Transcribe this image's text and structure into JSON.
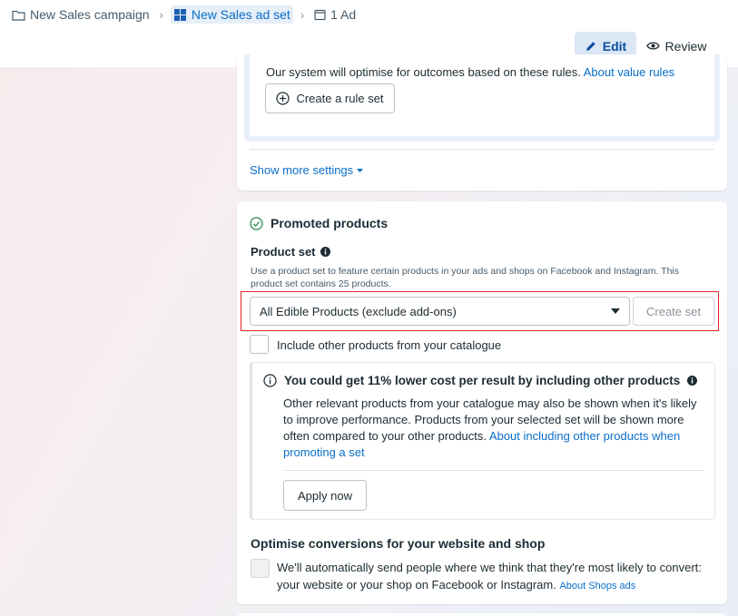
{
  "breadcrumb": {
    "campaign": "New Sales campaign",
    "ad_set": "New Sales ad set",
    "ad": "1 Ad"
  },
  "toolbar": {
    "edit_label": "Edit",
    "review_label": "Review"
  },
  "value_rules": {
    "text": "Our system will optimise for outcomes based on these rules.",
    "link": "About value rules",
    "create_button": "Create a rule set"
  },
  "show_more": "Show more settings",
  "promoted_products": {
    "title": "Promoted products",
    "product_set_label": "Product set",
    "help_text": "Use a product set to feature certain products in your ads and shops on Facebook and Instagram. This product set contains 25 products.",
    "selected_set": "All Edible Products (exclude add-ons)",
    "create_set": "Create set",
    "include_other": "Include other products from your catalogue",
    "info": {
      "title": "You could get 11% lower cost per result by including other products",
      "body": "Other relevant products from your catalogue may also be shown when it's likely to improve performance. Products from your selected set will be shown more often compared to your other products.",
      "link": "About including other products when promoting a set",
      "apply_button": "Apply now"
    }
  },
  "optimise": {
    "title": "Optimise conversions for your website and shop",
    "text": "We'll automatically send people where we think that they're most likely to convert: your website or your shop on Facebook or Instagram.",
    "link": "About Shops ads"
  },
  "colors": {
    "accent": "#0a6ec8",
    "highlight": "#e02424",
    "edit_bg": "#dbe7f5"
  }
}
